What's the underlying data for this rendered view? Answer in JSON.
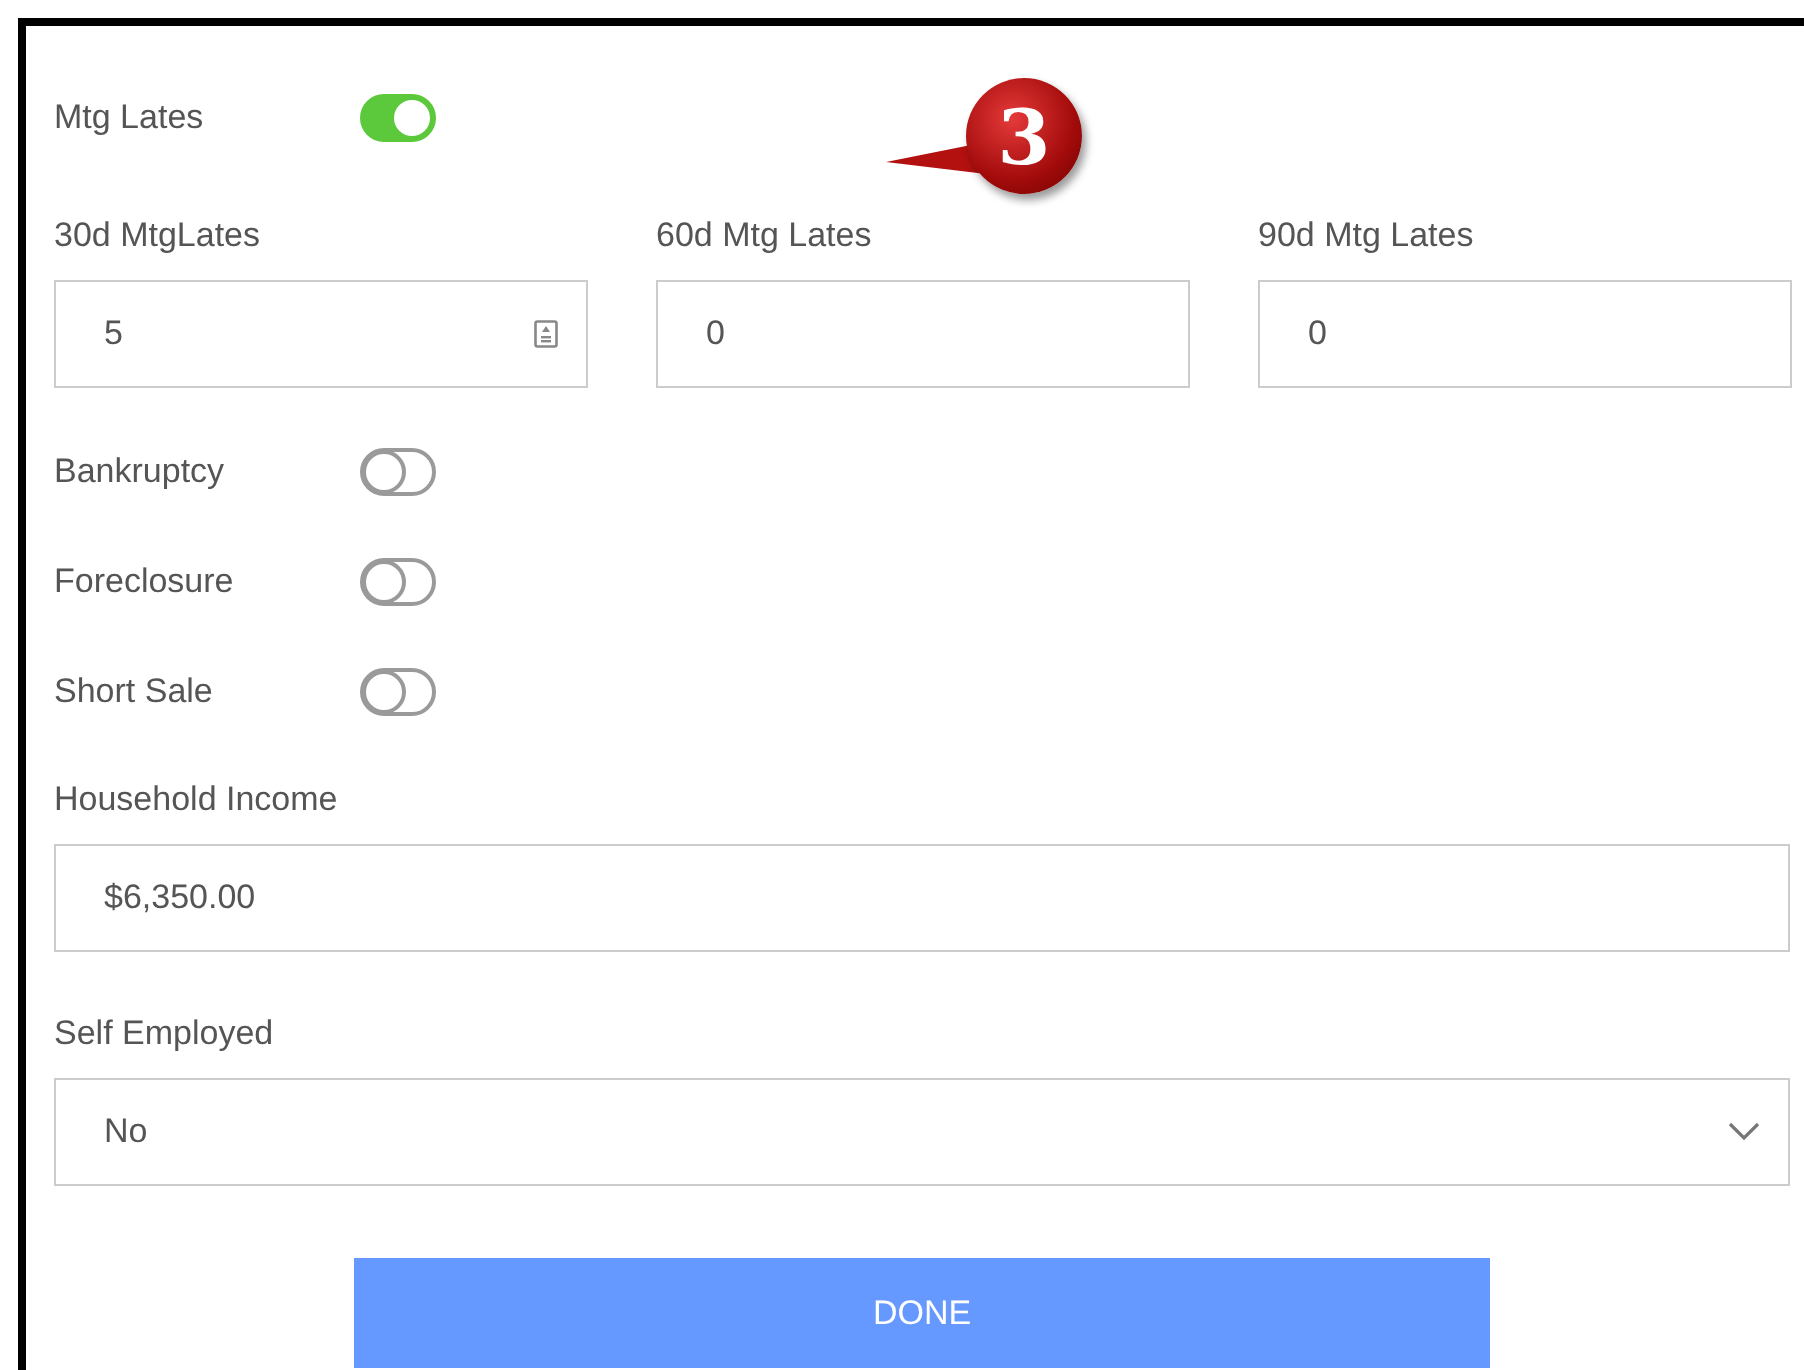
{
  "callout": {
    "text": "3"
  },
  "mtg_lates": {
    "label": "Mtg Lates",
    "on": true
  },
  "late_fields": [
    {
      "label": "30d MtgLates",
      "value": "5",
      "kind": "stepper"
    },
    {
      "label": "60d Mtg Lates",
      "value": "0",
      "kind": "plain"
    },
    {
      "label": "90d Mtg Lates",
      "value": "0",
      "kind": "plain"
    }
  ],
  "flags": [
    {
      "label": "Bankruptcy",
      "on": false
    },
    {
      "label": "Foreclosure",
      "on": false
    },
    {
      "label": "Short Sale",
      "on": false
    }
  ],
  "household_income": {
    "label": "Household Income",
    "value": "$6,350.00"
  },
  "self_employed": {
    "label": "Self Employed",
    "value": "No"
  },
  "done_button": {
    "label": "DONE"
  }
}
